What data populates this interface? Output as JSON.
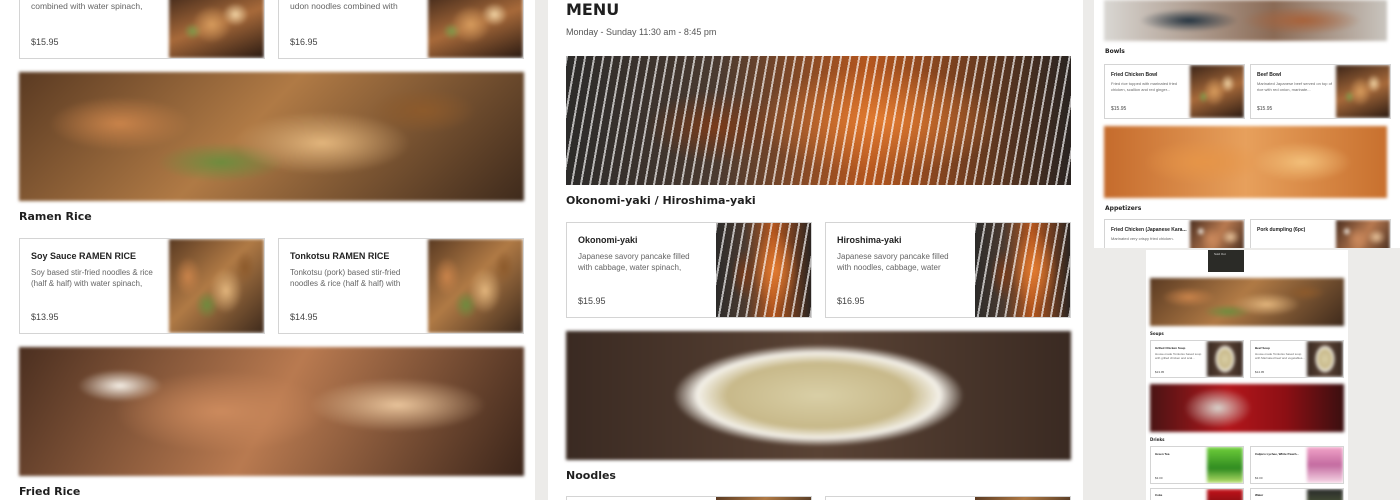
{
  "left_panel": {
    "top_cards": [
      {
        "desc": "combined with water spinach, red...",
        "price": "$15.95"
      },
      {
        "desc": "udon noodles combined with water...",
        "price": "$16.95"
      }
    ],
    "sections": [
      {
        "title": "Ramen Rice",
        "items": [
          {
            "name": "Soy Sauce RAMEN RICE",
            "desc": "Soy based stir-fried noodles & rice (half & half) with water spinach, red...",
            "price": "$13.95"
          },
          {
            "name": "Tonkotsu RAMEN RICE",
            "desc": "Tonkotsu (pork) based stir-fried noodles & rice (half & half) with wat...",
            "price": "$14.95"
          }
        ]
      },
      {
        "title": "Fried Rice"
      }
    ]
  },
  "center_panel": {
    "title": "MENU",
    "hours": "Monday - Sunday 11:30 am - 8:45 pm",
    "sections": [
      {
        "title": "Okonomi-yaki / Hiroshima-yaki",
        "items": [
          {
            "name": "Okonomi-yaki",
            "desc": "Japanese savory pancake filled with cabbage, water spinach, scallion, re...",
            "price": "$15.95"
          },
          {
            "name": "Hiroshima-yaki",
            "desc": "Japanese savory pancake filled with noodles, cabbage, water spinach,...",
            "price": "$16.95"
          }
        ]
      },
      {
        "title": "Noodles"
      }
    ]
  },
  "right_top_panel": {
    "sections": [
      {
        "title": "Bowls",
        "items": [
          {
            "name": "Fried Chicken Bowl",
            "desc": "Fried rice topped with marinated fried chicken, scallion and red ginger...",
            "price": "$15.95"
          },
          {
            "name": "Beef Bowl",
            "desc": "Marinated Japanese beef served on top of rice with red onion, marinate...",
            "price": "$15.95"
          }
        ]
      },
      {
        "title": "Appetizers",
        "items": [
          {
            "name": "Fried Chicken (Japanese Kara...",
            "desc": "Marinated very crispy fried chicken."
          },
          {
            "name": "Pork dumpling (6pc)",
            "desc": ""
          }
        ]
      }
    ]
  },
  "right_bottom_panel": {
    "sold_out": "Sold Out",
    "sections": [
      {
        "title": "Soups",
        "items": [
          {
            "name": "Grilled Chicken Soup",
            "desc": "House-made Tonkotsu based soup with grilled chicken and scal...",
            "price": "$13.95"
          },
          {
            "name": "Beef Soup",
            "desc": "House-made Tonkotsu based soup with Marinated beef and vegetables...",
            "price": "$14.95"
          }
        ]
      },
      {
        "title": "Drinks",
        "items": [
          {
            "name": "Green Tea",
            "price": "$3.00"
          },
          {
            "name": "Calpico Lychee, White Peach...",
            "price": "$3.00"
          },
          {
            "name": "Coke"
          },
          {
            "name": "Water"
          }
        ]
      }
    ]
  }
}
